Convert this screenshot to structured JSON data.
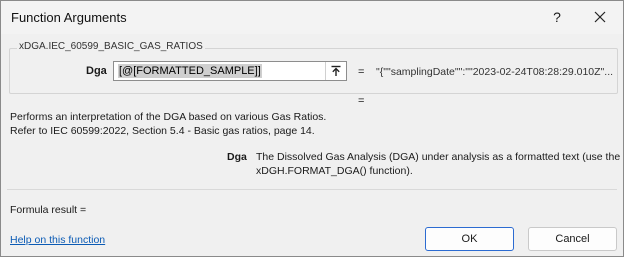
{
  "dialog": {
    "title": "Function Arguments",
    "help_glyph": "?",
    "close_icon": "close-icon"
  },
  "function": {
    "name": "xDGA.IEC_60599_BASIC_GAS_RATIOS",
    "argument": {
      "label": "Dga",
      "input_value": "[@[FORMATTED_SAMPLE]]",
      "collapse_icon": "collapse-arrow-icon",
      "equals": "=",
      "evaluated_value": "\"{\"\"samplingDate\"\":\"\"2023-02-24T08:28:29.010Z\"..."
    },
    "result_equals": "=",
    "description": [
      "Performs an interpretation of the DGA based on various Gas Ratios.",
      "Refer to IEC 60599:2022, Section 5.4 - Basic gas ratios, page 14."
    ],
    "argument_help": {
      "label": "Dga",
      "lines": [
        "The Dissolved Gas Analysis (DGA) under analysis as a formatted text (use the",
        "xDGH.FORMAT_DGA() function)."
      ]
    }
  },
  "footer": {
    "formula_result": "Formula result =",
    "help_link": "Help on this function",
    "ok_label": "OK",
    "cancel_label": "Cancel"
  },
  "colors": {
    "link": "#0b5bb5",
    "ok_border": "#2c6bd1",
    "selection": "#cfcfcf"
  }
}
